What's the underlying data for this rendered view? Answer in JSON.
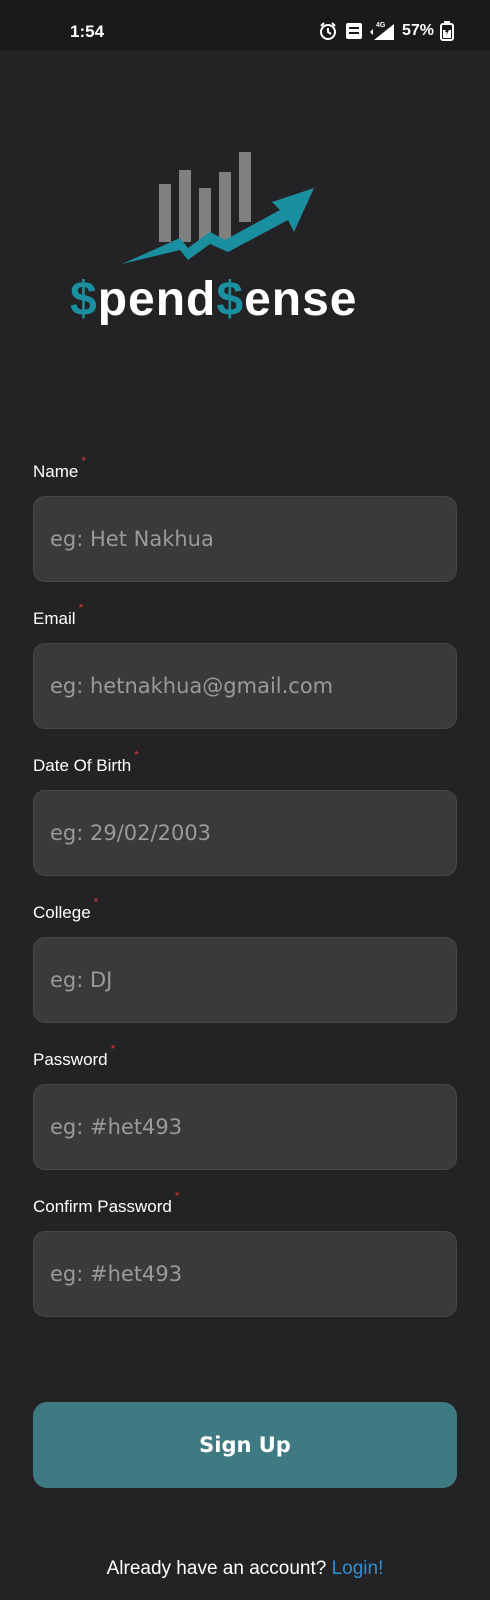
{
  "status_bar": {
    "time": "1:54",
    "battery": "57%",
    "network": "4G",
    "icons": [
      "alarm-icon",
      "volte-icon",
      "signal-icon",
      "battery-icon"
    ]
  },
  "logo": {
    "dollar_1": "$",
    "word_1": "pend",
    "dollar_2": "$",
    "word_2": "ense",
    "accent_color": "#1a8fa0"
  },
  "form": {
    "required_mark": "*",
    "fields": [
      {
        "label": "Name",
        "placeholder": "eg: Het Nakhua",
        "value": ""
      },
      {
        "label": "Email",
        "placeholder": "eg: hetnakhua@gmail.com",
        "value": ""
      },
      {
        "label": "Date Of Birth",
        "placeholder": "eg: 29/02/2003",
        "value": ""
      },
      {
        "label": "College",
        "placeholder": "eg: DJ",
        "value": ""
      },
      {
        "label": "Password",
        "placeholder": "eg: #het493",
        "value": ""
      },
      {
        "label": "Confirm Password",
        "placeholder": "eg: #het493",
        "value": ""
      }
    ]
  },
  "signup_button": {
    "label": "Sign Up",
    "color": "#3f7a82"
  },
  "footer": {
    "prompt": "Already have an account? ",
    "login_link": "Login!",
    "link_color": "#2f8fd3"
  }
}
